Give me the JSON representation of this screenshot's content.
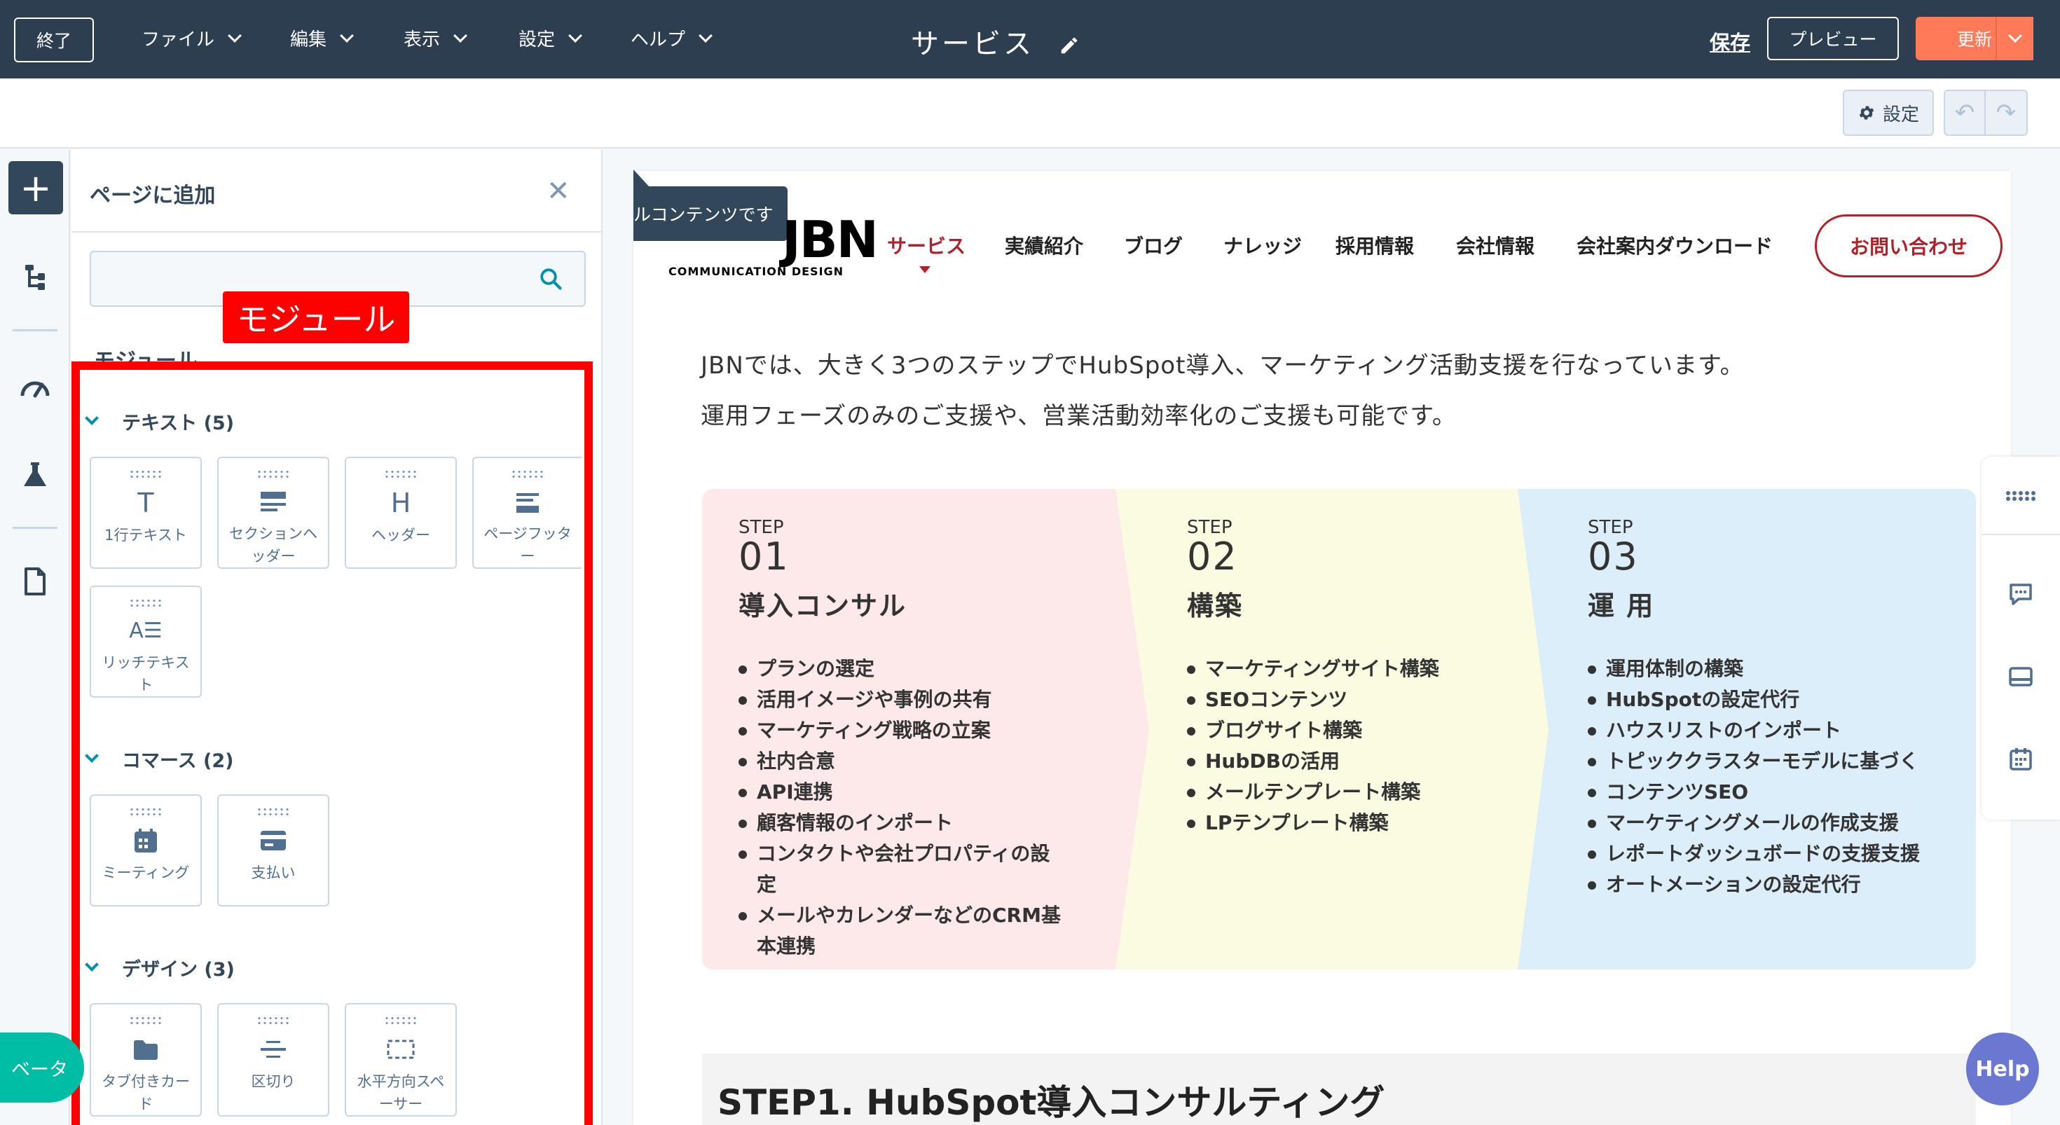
{
  "topbar": {
    "exit": "終了",
    "menus": [
      "ファイル",
      "編集",
      "表示",
      "設定",
      "ヘルプ"
    ],
    "page_title": "サービス",
    "save": "保存",
    "preview": "プレビュー",
    "update": "更新"
  },
  "subbar": {
    "settings": "設定"
  },
  "panel": {
    "title": "ページに追加",
    "search_placeholder": "",
    "annotation": "モジュール",
    "modules_heading": "モジュール",
    "sections": [
      {
        "title": "テキスト (5)",
        "items": [
          "1行テキスト",
          "セクションヘッダー",
          "ヘッダー",
          "ページフッター",
          "リッチテキスト"
        ]
      },
      {
        "title": "コマース (2)",
        "items": [
          "ミーティング",
          "支払い"
        ]
      },
      {
        "title": "デザイン (3)",
        "items": [
          "タブ付きカード",
          "区切り",
          "水平方向スペーサー"
        ]
      }
    ]
  },
  "canvas": {
    "tooltip": "ルコンテンツです",
    "logo": "JBN",
    "logo_sub": "COMMUNICATION DESIGN",
    "nav": [
      "サービス",
      "実績紹介",
      "ブログ",
      "ナレッジ",
      "採用情報",
      "会社情報",
      "会社案内ダウンロード"
    ],
    "contact": "お問い合わせ",
    "intro_1": "JBNでは、大きく3つのステップでHubSpot導入、マーケティング活動支援を行なっています。",
    "intro_2": "運用フェーズのみのご支援や、営業活動効率化のご支援も可能です。",
    "steps": [
      {
        "label": "STEP",
        "num": "01",
        "title": "導入コンサル",
        "color": "#fde8ea",
        "items": [
          "プランの選定",
          "活用イメージや事例の共有",
          "マーケティング戦略の立案",
          "社内合意",
          "API連携",
          "顧客情報のインポート",
          "コンタクトや会社プロパティの設定",
          "メールやカレンダーなどのCRM基本連携"
        ]
      },
      {
        "label": "STEP",
        "num": "02",
        "title": "構築",
        "color": "#fafbe0",
        "items": [
          "マーケティングサイト構築",
          "SEOコンテンツ",
          "ブログサイト構築",
          "HubDBの活用",
          "メールテンプレート構築",
          "LPテンプレート構築"
        ]
      },
      {
        "label": "STEP",
        "num": "03",
        "title": "運 用",
        "color": "#ddeefb",
        "items": [
          "運用体制の構築",
          "HubSpotの設定代行",
          "ハウスリストのインポート",
          "トピッククラスターモデルに基づく",
          "コンテンツSEO",
          "マーケティングメールの作成支援",
          "レポートダッシュボードの支援支援",
          "オートメーションの設定代行"
        ]
      }
    ],
    "step1_heading": "STEP1. HubSpot導入コンサルティング"
  },
  "beta": "ベータ",
  "help": "Help",
  "colors": {
    "topbar": "#2d3e50",
    "accent": "#ff7a59",
    "brand_red": "#b0222a",
    "annotation_red": "#ff0000",
    "help": "#6a78d1",
    "beta": "#00bda5"
  }
}
